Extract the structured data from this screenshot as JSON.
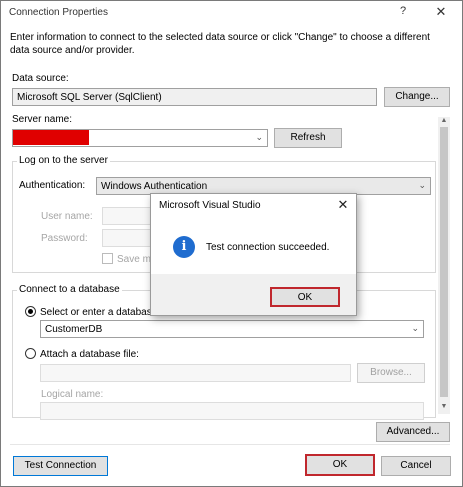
{
  "window": {
    "title": "Connection Properties",
    "help_glyph": "?",
    "close_glyph": "✕"
  },
  "intro_text": "Enter information to connect to the selected data source or click \"Change\" to choose a different data source and/or provider.",
  "data_source": {
    "label": "Data source:",
    "value": "Microsoft SQL Server (SqlClient)",
    "change_button": "Change..."
  },
  "server": {
    "label": "Server name:",
    "value": "",
    "refresh_button": "Refresh"
  },
  "logon": {
    "group_title": "Log on to the server",
    "auth_label": "Authentication:",
    "auth_value": "Windows Authentication",
    "username_label": "User name:",
    "password_label": "Password:",
    "save_password_label": "Save m"
  },
  "database": {
    "group_title": "Connect to a database",
    "select_label": "Select or enter a database",
    "select_value": "CustomerDB",
    "attach_label": "Attach a database file:",
    "browse_button": "Browse...",
    "logical_name_label": "Logical name:"
  },
  "advanced_button": "Advanced...",
  "test_connection_button": "Test Connection",
  "ok_button": "OK",
  "cancel_button": "Cancel",
  "message_box": {
    "title": "Microsoft Visual Studio",
    "close_glyph": "✕",
    "icon_glyph": "i",
    "message": "Test connection succeeded.",
    "ok_button": "OK"
  },
  "scrollbar": {
    "up_glyph": "▲",
    "down_glyph": "▼"
  },
  "colors": {
    "highlight": "#c0272d",
    "info_icon": "#1f6ccf",
    "redacted": "#e00000"
  }
}
